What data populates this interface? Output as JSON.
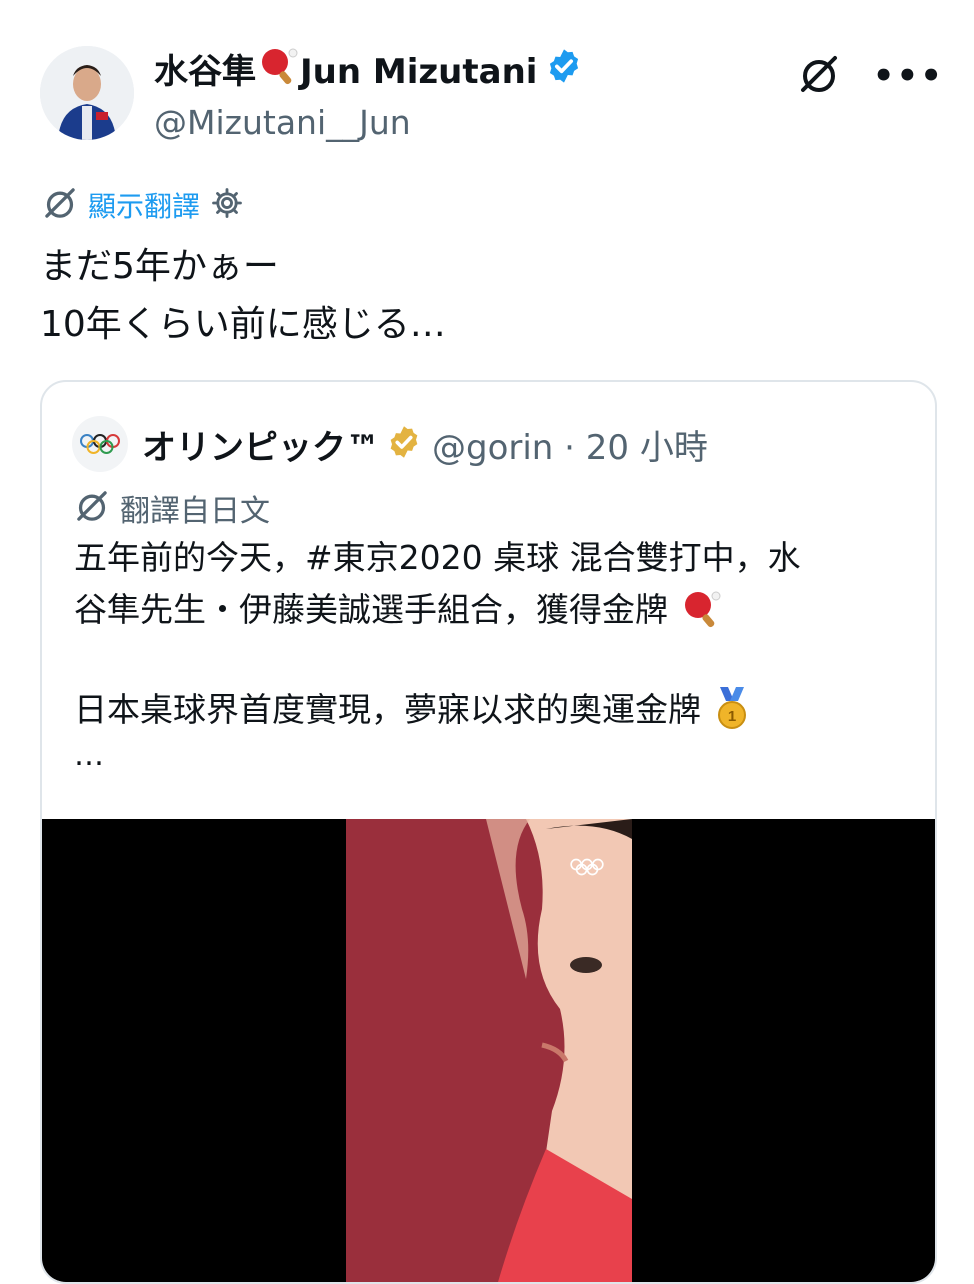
{
  "tweet": {
    "author_name": "水谷隼",
    "author_name_en": "Jun Mizutani",
    "handle": "@Mizutani__Jun",
    "translate_label": "顯示翻譯",
    "text_line1": "まだ5年かぁー",
    "text_line2": "10年くらい前に感じる…",
    "more_label": "•••",
    "icons": [
      "grok-icon",
      "more-icon",
      "verified-blue-icon",
      "ping-pong-paddle-icon"
    ]
  },
  "quoted": {
    "name": "オリンピック™",
    "meta": "@gorin · 20 小時",
    "translate_label": "翻譯自日文",
    "line1": "五年前的今天，#東京2020 桌球 混合雙打中，水",
    "line2": "谷隼先生・伊藤美誠選手組合，獲得金牌",
    "line3": "日本桌球界首度實現，夢寐以求的奧運金牌",
    "ellipsis": "…",
    "icons": [
      "olympic-rings-icon",
      "verified-gold-icon",
      "gold-medal-icon"
    ]
  },
  "colors": {
    "accent": "#1d9bf0",
    "gold": "#e3b341",
    "photo_bg": "#9a2f3c"
  }
}
